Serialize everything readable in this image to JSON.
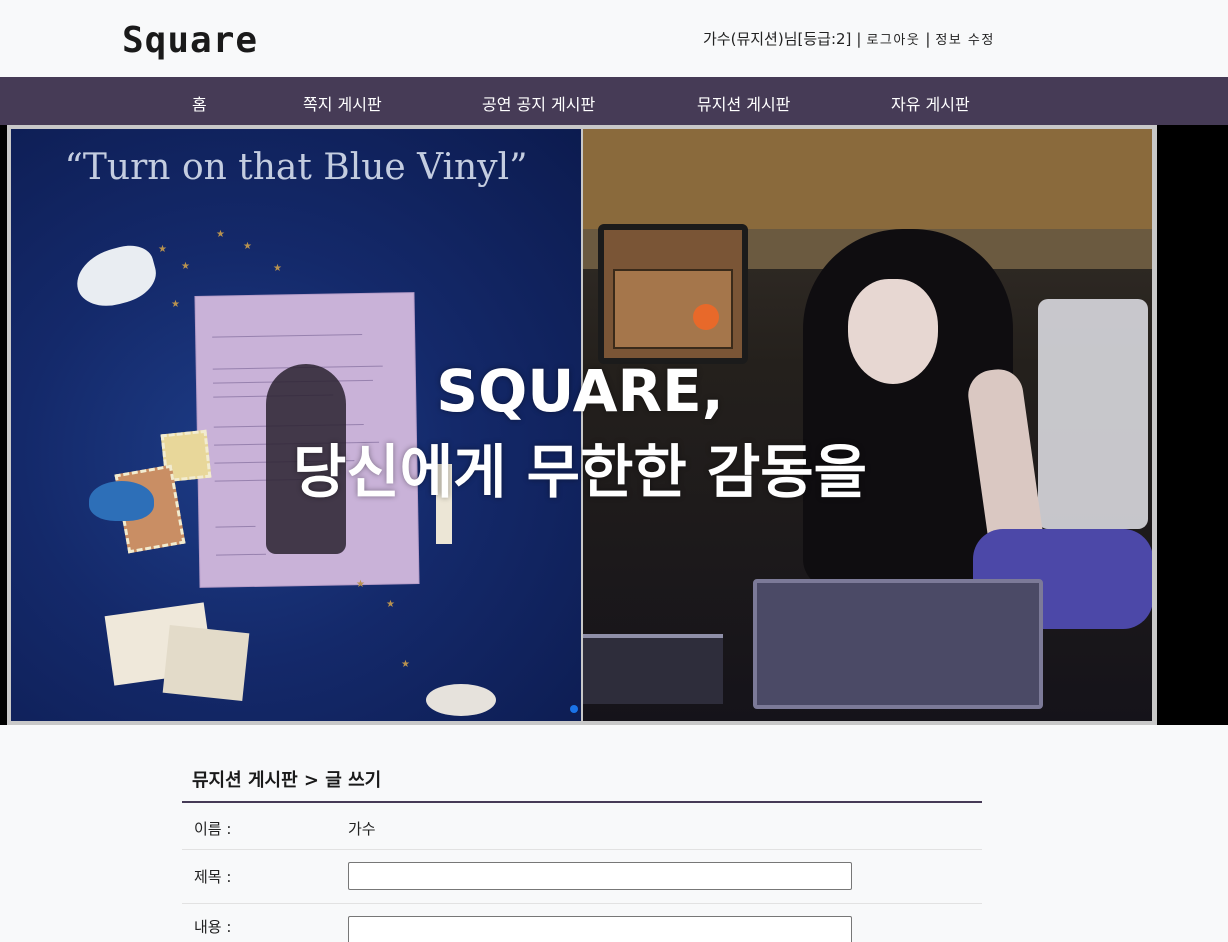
{
  "header": {
    "logo": "Square",
    "user_info": "가수(뮤지션)님[등급:2]",
    "separator": "|",
    "logout": "로그아웃",
    "edit_profile": "정보 수정"
  },
  "nav": {
    "items": [
      {
        "label": "홈"
      },
      {
        "label": "쪽지 게시판"
      },
      {
        "label": "공연 공지 게시판"
      },
      {
        "label": "뮤지션 게시판"
      },
      {
        "label": "자유 게시판"
      }
    ]
  },
  "hero": {
    "album_title": "“Turn on that Blue Vinyl”",
    "line1": "SQUARE,",
    "line2": "당신에게 무한한 감동을"
  },
  "form": {
    "title": "뮤지션 게시판 > 글 쓰기",
    "name_label": "이름 :",
    "name_value": "가수",
    "subject_label": "제목 :",
    "subject_value": "",
    "content_label": "내용 :",
    "content_value": ""
  }
}
